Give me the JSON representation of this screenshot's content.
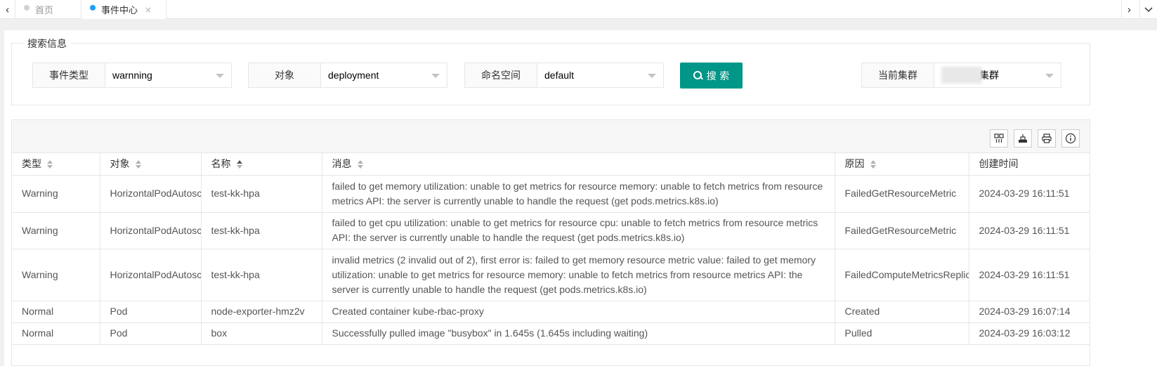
{
  "tabs": {
    "prev_label": "‹",
    "next_label": "›",
    "more_label": "⌄",
    "items": [
      {
        "label": "首页",
        "active": false
      },
      {
        "label": "事件中心",
        "active": true,
        "close": "×"
      }
    ]
  },
  "search": {
    "legend": "搜索信息",
    "event_type": {
      "label": "事件类型",
      "value": "warnning"
    },
    "object": {
      "label": "对象",
      "value": "deployment"
    },
    "namespace": {
      "label": "命名空间",
      "value": "default"
    },
    "search_button": "搜 索",
    "cluster": {
      "label": "当前集群",
      "value": "集群"
    }
  },
  "toolbar": {
    "icons": [
      "columns-icon",
      "export-icon",
      "print-icon",
      "info-icon"
    ]
  },
  "table": {
    "headers": [
      "类型",
      "对象",
      "名称",
      "消息",
      "原因",
      "创建时间"
    ],
    "rows": [
      {
        "type": "Warning",
        "object": "HorizontalPodAutoscaler",
        "name": "test-kk-hpa",
        "message": "failed to get memory utilization: unable to get metrics for resource memory: unable to fetch metrics from resource metrics API: the server is currently unable to handle the request (get pods.metrics.k8s.io)",
        "reason": "FailedGetResourceMetric",
        "created": "2024-03-29 16:11:51"
      },
      {
        "type": "Warning",
        "object": "HorizontalPodAutoscaler",
        "name": "test-kk-hpa",
        "message": "failed to get cpu utilization: unable to get metrics for resource cpu: unable to fetch metrics from resource metrics API: the server is currently unable to handle the request (get pods.metrics.k8s.io)",
        "reason": "FailedGetResourceMetric",
        "created": "2024-03-29 16:11:51"
      },
      {
        "type": "Warning",
        "object": "HorizontalPodAutoscaler",
        "name": "test-kk-hpa",
        "message": "invalid metrics (2 invalid out of 2), first error is: failed to get memory resource metric value: failed to get memory utilization: unable to get metrics for resource memory: unable to fetch metrics from resource metrics API: the server is currently unable to handle the request (get pods.metrics.k8s.io)",
        "reason": "FailedComputeMetricsReplicas",
        "created": "2024-03-29 16:11:51"
      },
      {
        "type": "Normal",
        "object": "Pod",
        "name": "node-exporter-hmz2v",
        "message": "Created container kube-rbac-proxy",
        "reason": "Created",
        "created": "2024-03-29 16:07:14"
      },
      {
        "type": "Normal",
        "object": "Pod",
        "name": "box",
        "message": "Successfully pulled image \"busybox\" in 1.645s (1.645s including waiting)",
        "reason": "Pulled",
        "created": "2024-03-29 16:03:12"
      }
    ]
  }
}
